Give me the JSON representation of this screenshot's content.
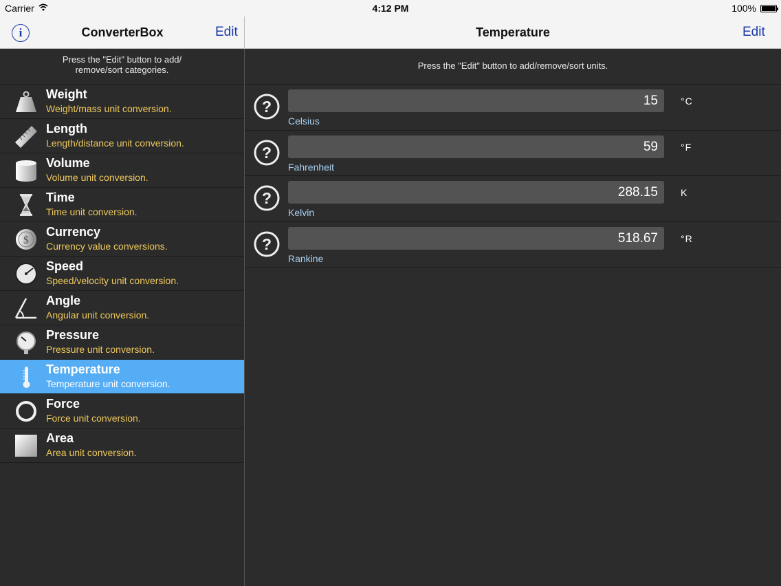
{
  "status": {
    "carrier": "Carrier",
    "time": "4:12 PM",
    "battery": "100%"
  },
  "left_nav": {
    "info": "i",
    "title": "ConverterBox",
    "edit": "Edit"
  },
  "right_nav": {
    "title": "Temperature",
    "edit": "Edit"
  },
  "left_hint": {
    "line1": "Press the \"Edit\" button to add/",
    "line2": "remove/sort categories."
  },
  "right_hint": "Press the \"Edit\" button to add/remove/sort units.",
  "categories": [
    {
      "name": "Weight",
      "desc": "Weight/mass unit conversion.",
      "icon": "weight-icon"
    },
    {
      "name": "Length",
      "desc": "Length/distance unit conversion.",
      "icon": "ruler-icon"
    },
    {
      "name": "Volume",
      "desc": "Volume unit conversion.",
      "icon": "cylinder-icon"
    },
    {
      "name": "Time",
      "desc": "Time unit conversion.",
      "icon": "hourglass-icon"
    },
    {
      "name": "Currency",
      "desc": "Currency value conversions.",
      "icon": "dollar-coin-icon"
    },
    {
      "name": "Speed",
      "desc": "Speed/velocity unit conversion.",
      "icon": "speedometer-icon"
    },
    {
      "name": "Angle",
      "desc": "Angular unit conversion.",
      "icon": "angle-icon"
    },
    {
      "name": "Pressure",
      "desc": "Pressure unit conversion.",
      "icon": "pressure-gauge-icon"
    },
    {
      "name": "Temperature",
      "desc": "Temperature unit conversion.",
      "icon": "thermometer-icon",
      "selected": true
    },
    {
      "name": "Force",
      "desc": "Force unit conversion.",
      "icon": "ring-icon"
    },
    {
      "name": "Area",
      "desc": "Area unit conversion.",
      "icon": "square-icon"
    }
  ],
  "units": [
    {
      "value": "15",
      "name": "Celsius",
      "symbol": "°C"
    },
    {
      "value": "59",
      "name": "Fahrenheit",
      "symbol": "°F"
    },
    {
      "value": "288.15",
      "name": "Kelvin",
      "symbol": "K"
    },
    {
      "value": "518.67",
      "name": "Rankine",
      "symbol": "°R"
    }
  ],
  "colors": {
    "accent": "#1a3ba8",
    "selected_row": "#55adf5",
    "desc_text": "#efc95c",
    "unit_name": "#a9d0f1"
  }
}
